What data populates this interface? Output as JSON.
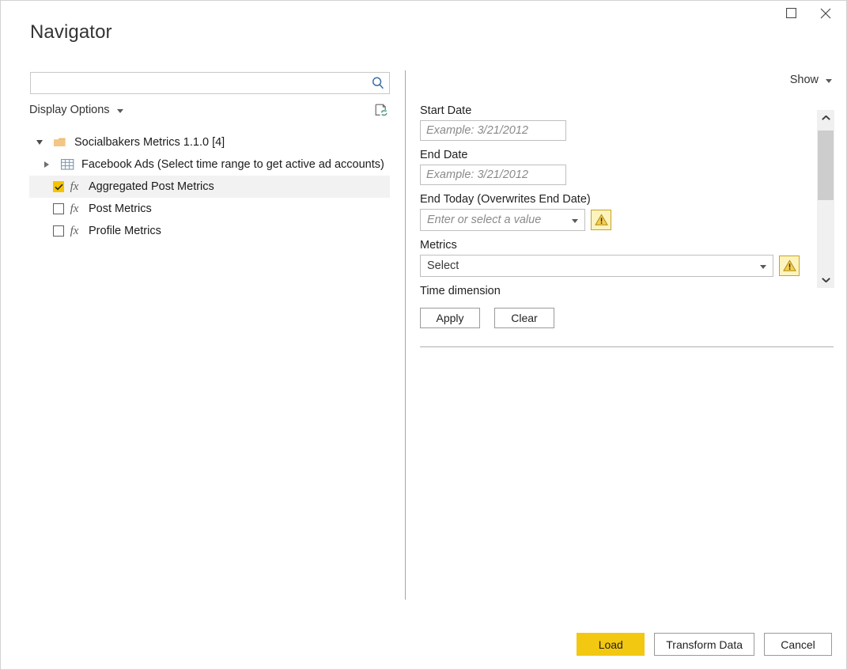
{
  "window": {
    "title": "Navigator",
    "maximize_icon": "maximize-icon",
    "close_icon": "close-icon"
  },
  "search": {
    "value": "",
    "placeholder": "",
    "icon": "search-icon"
  },
  "left_pane": {
    "display_options_label": "Display Options",
    "refresh_preview_icon": "refresh-document-icon",
    "tree": [
      {
        "label": "Socialbakers Metrics 1.1.0 [4]",
        "level": 0,
        "expander": "triangle-down",
        "icon": "folder-icon",
        "checkbox": null,
        "selected": false
      },
      {
        "label": "Facebook Ads (Select time range to get active ad accounts)",
        "level": 1,
        "expander": "triangle-right",
        "icon": "table-icon",
        "checkbox": null,
        "selected": false
      },
      {
        "label": "Aggregated Post Metrics",
        "level": 1,
        "expander": null,
        "icon": "fx-icon",
        "checkbox": "checked",
        "selected": true
      },
      {
        "label": "Post Metrics",
        "level": 1,
        "expander": null,
        "icon": "fx-icon",
        "checkbox": "unchecked",
        "selected": false
      },
      {
        "label": "Profile Metrics",
        "level": 1,
        "expander": null,
        "icon": "fx-icon",
        "checkbox": "unchecked",
        "selected": false
      }
    ]
  },
  "right_pane": {
    "show_label": "Show",
    "fields": {
      "start_date": {
        "label": "Start Date",
        "value": "",
        "placeholder": "Example: 3/21/2012"
      },
      "end_date": {
        "label": "End Date",
        "value": "",
        "placeholder": "Example: 3/21/2012"
      },
      "end_today": {
        "label": "End Today (Overwrites End Date)",
        "value": "",
        "placeholder": "Enter or select a value",
        "warning_icon": "warning-icon"
      },
      "metrics": {
        "label": "Metrics",
        "value": "Select",
        "warning_icon": "warning-icon"
      },
      "time_dimension": {
        "label": "Time dimension"
      }
    },
    "apply_label": "Apply",
    "clear_label": "Clear",
    "scrollbar": {
      "up_icon": "chevron-up-icon",
      "down_icon": "chevron-down-icon"
    }
  },
  "footer": {
    "load_label": "Load",
    "transform_label": "Transform Data",
    "cancel_label": "Cancel"
  },
  "colors": {
    "accent": "#f2c811",
    "checkbox_checked": "#f5c400",
    "warning_bg": "#fdf3bd",
    "warning_border": "#c9a227",
    "folder": "#f0c078",
    "search_icon": "#3b6ea5"
  }
}
